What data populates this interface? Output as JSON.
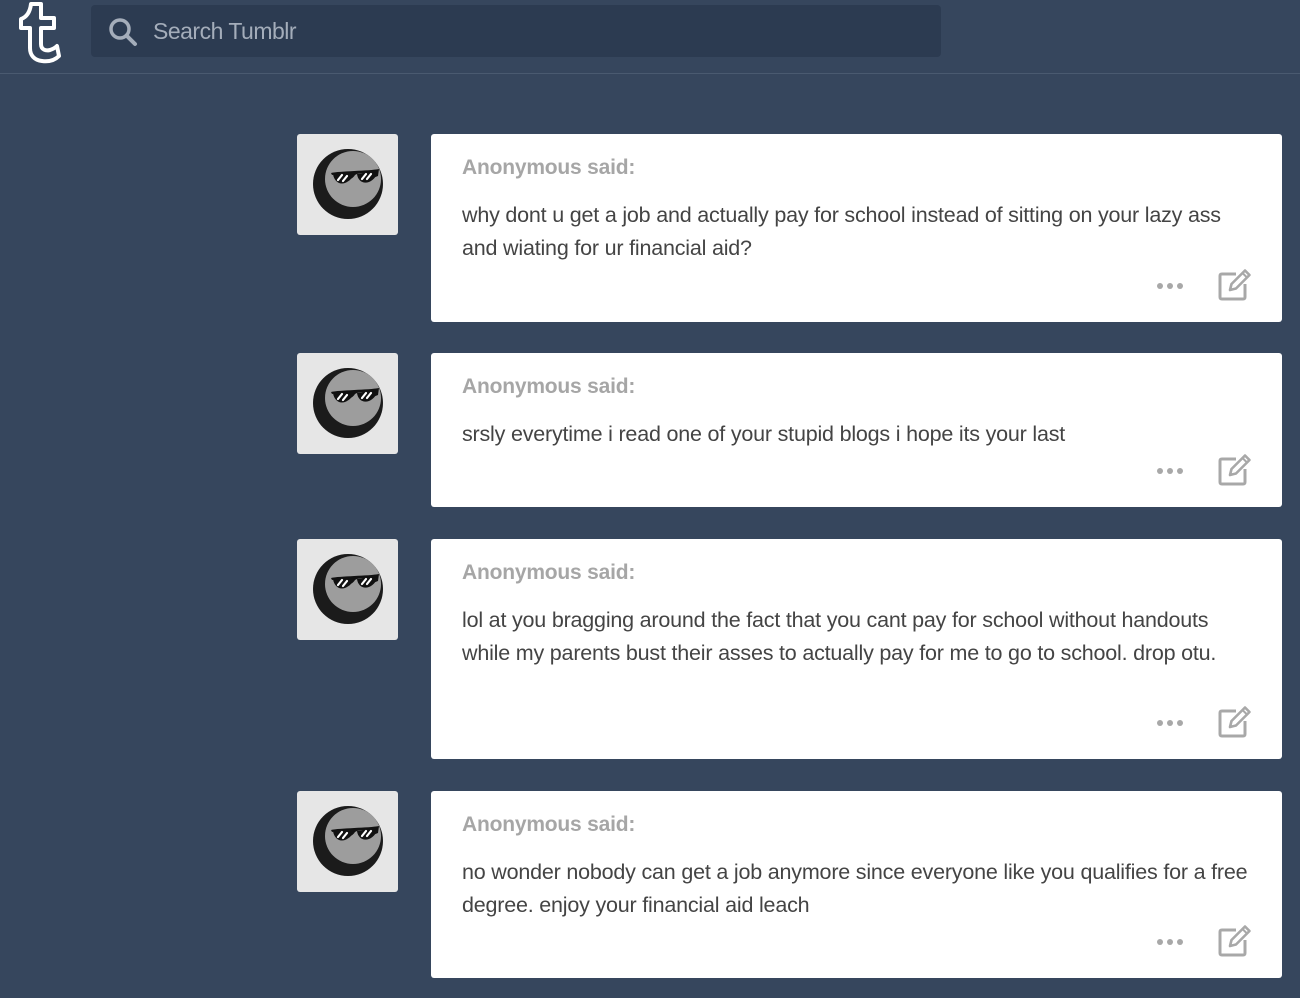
{
  "header": {
    "logo_icon": "tumblr-logo-icon",
    "search": {
      "icon": "search-icon",
      "placeholder": "Search Tumblr"
    }
  },
  "posts": [
    {
      "asker": "Anonymous said:",
      "question": "why dont u get a job and actually pay for school instead of sitting on your lazy ass and wiating for ur financial aid?"
    },
    {
      "asker": "Anonymous said:",
      "question": "srsly everytime i read one of your stupid blogs i hope its your last"
    },
    {
      "asker": "Anonymous said:",
      "question": "lol at you bragging around the fact that you cant pay for school without handouts while my parents bust their asses to actually pay for me to go to school. drop otu."
    },
    {
      "asker": "Anonymous said:",
      "question": "no wonder nobody can get a job anymore since everyone like you qualifies for a free degree. enjoy your financial aid leach"
    }
  ],
  "colors": {
    "background": "#36465d",
    "search_bg": "#2c3b51",
    "card_bg": "#ffffff",
    "asker_text": "#a6a6a6",
    "question_text": "#444444",
    "action_icons": "#a8a8a8"
  }
}
